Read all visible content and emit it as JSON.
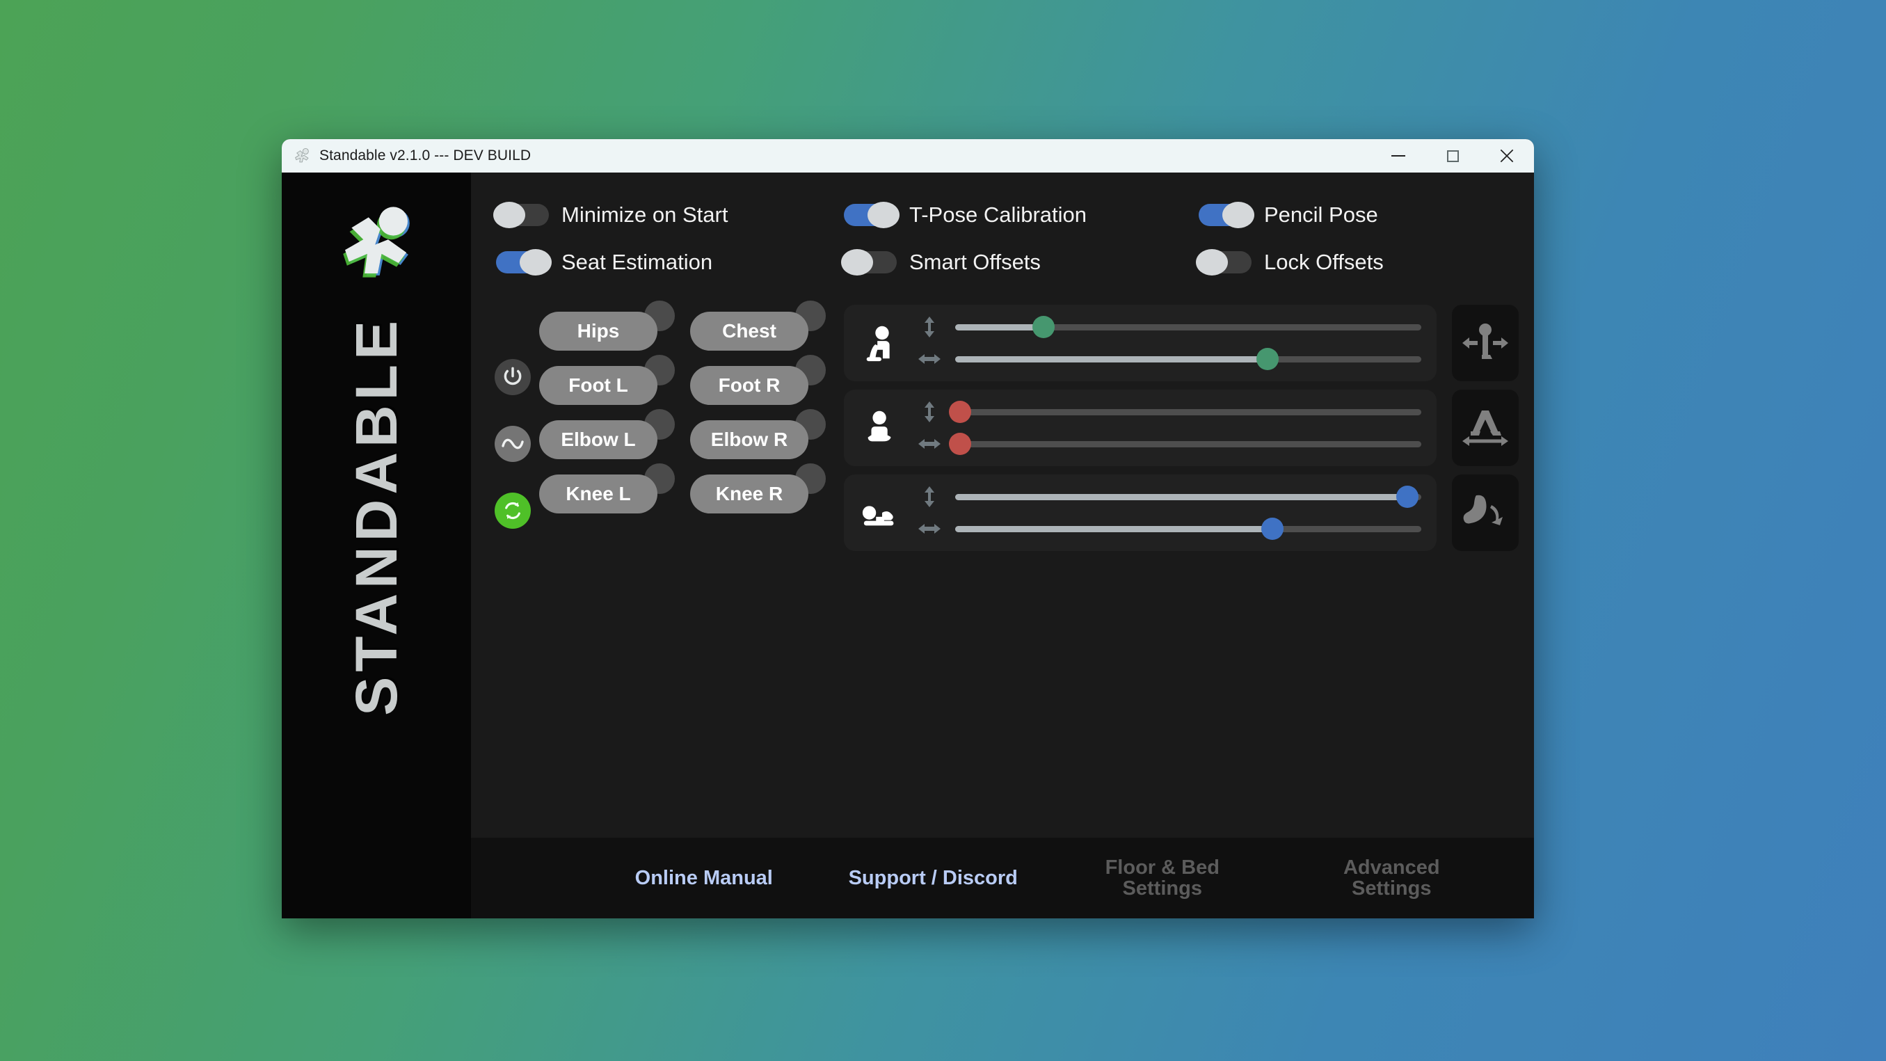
{
  "window": {
    "title": "Standable v2.1.0 --- DEV BUILD",
    "app_icon": "standable-person-icon",
    "controls": {
      "minimize": "minimize-icon",
      "maximize": "maximize-icon",
      "close": "close-icon"
    }
  },
  "sidebar": {
    "logo_icon": "standable-person-logo",
    "wordmark": "STANDABLE"
  },
  "toggles": [
    {
      "label": "Minimize on Start",
      "on": false
    },
    {
      "label": "T-Pose Calibration",
      "on": true
    },
    {
      "label": "Pencil Pose",
      "on": true
    },
    {
      "label": "Seat Estimation",
      "on": true
    },
    {
      "label": "Smart Offsets",
      "on": false
    },
    {
      "label": "Lock Offsets",
      "on": false
    }
  ],
  "side_icons": [
    {
      "name": "power-icon",
      "color": "#444444"
    },
    {
      "name": "wave-icon",
      "color": "#757575"
    },
    {
      "name": "reload-icon",
      "color": "#4fc028"
    }
  ],
  "body_parts": [
    {
      "label": "Hips",
      "indicator": "off"
    },
    {
      "label": "Chest",
      "indicator": "off"
    },
    {
      "label": "Foot L",
      "indicator": "off"
    },
    {
      "label": "Foot R",
      "indicator": "off"
    },
    {
      "label": "Elbow L",
      "indicator": "off"
    },
    {
      "label": "Elbow R",
      "indicator": "off"
    },
    {
      "label": "Knee L",
      "indicator": "off"
    },
    {
      "label": "Knee R",
      "indicator": "off"
    }
  ],
  "slider_panels": [
    {
      "pose": "sitting-chair-icon",
      "color": "#46976f",
      "sliders": [
        {
          "axis": "vertical-arrow-icon",
          "value": 19
        },
        {
          "axis": "horizontal-arrow-icon",
          "value": 67
        }
      ]
    },
    {
      "pose": "sitting-floor-icon",
      "color": "#c0504a",
      "sliders": [
        {
          "axis": "vertical-arrow-icon",
          "value": 1
        },
        {
          "axis": "horizontal-arrow-icon",
          "value": 1
        }
      ]
    },
    {
      "pose": "lying-down-icon",
      "color": "#3f72c4",
      "sliders": [
        {
          "axis": "vertical-arrow-icon",
          "value": 97
        },
        {
          "axis": "horizontal-arrow-icon",
          "value": 68
        }
      ]
    }
  ],
  "action_buttons": [
    {
      "name": "body-width-icon"
    },
    {
      "name": "leg-spacing-icon"
    },
    {
      "name": "foot-rotation-icon"
    }
  ],
  "footer": [
    {
      "label": "Online Manual",
      "style": "link"
    },
    {
      "label": "Support / Discord",
      "style": "link"
    },
    {
      "label": "Floor & Bed\nSettings",
      "style": "muted"
    },
    {
      "label": "Advanced\nSettings",
      "style": "muted"
    }
  ],
  "colors": {
    "accent_blue": "#4072c4",
    "accent_green": "#46976f",
    "accent_red": "#c0504a",
    "reload_green": "#4fc028",
    "link_blue": "#b9ccf5",
    "panel_bg": "#212121",
    "window_bg": "#1a1a1a"
  }
}
